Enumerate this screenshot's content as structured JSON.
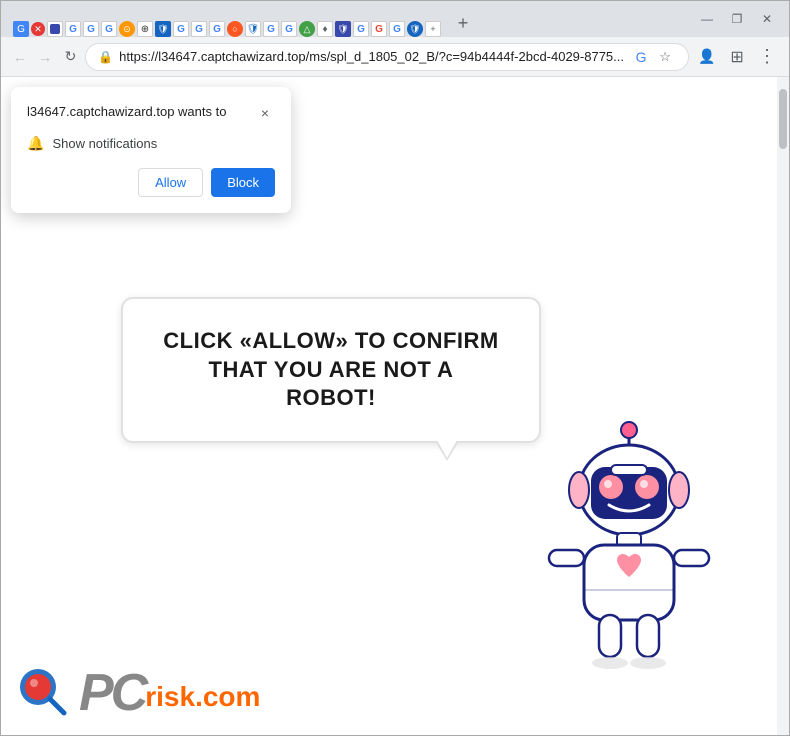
{
  "browser": {
    "tab": {
      "title": "l34647.captchawizard.top",
      "favicon_color": "#4285f4"
    },
    "address_bar": {
      "url": "https://l34647.captchawizard.top/ms/spl_d_1805_02_B/?c=94b4444f-2bcd-4029-8775...",
      "lock_icon": "🔒"
    },
    "window_controls": {
      "minimize": "—",
      "maximize": "❐",
      "close": "✕"
    }
  },
  "notification_popup": {
    "title": "l34647.captchawizard.top wants to",
    "permission": "Show notifications",
    "allow_label": "Allow",
    "block_label": "Block",
    "close_icon": "×"
  },
  "page": {
    "bubble_text": "CLICK «ALLOW» TO CONFIRM THAT YOU ARE NOT A ROBOT!",
    "pcrisk_domain": "risk.com"
  }
}
